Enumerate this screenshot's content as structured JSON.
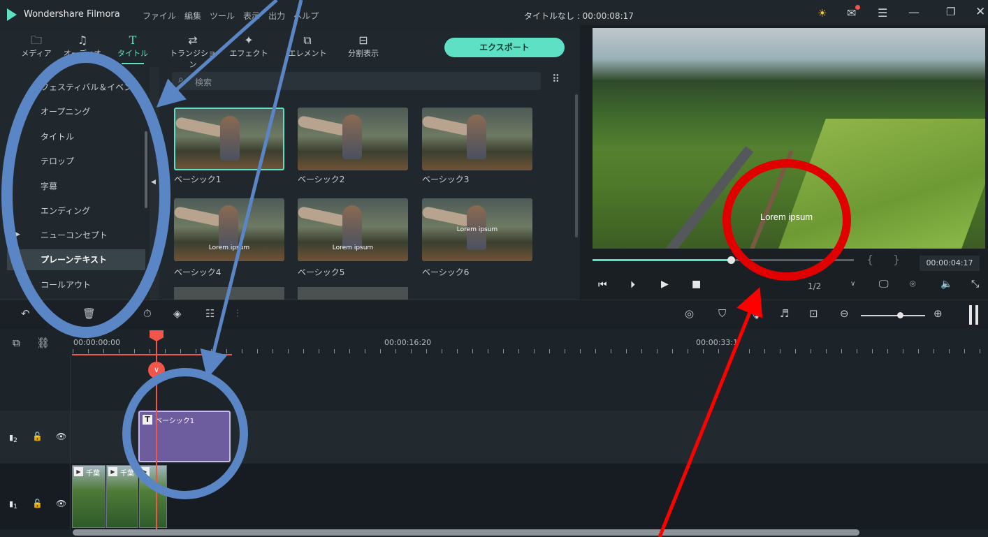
{
  "window": {
    "app_name": "Wondershare Filmora",
    "title": "タイトルなし : 00:00:08:17",
    "menu": [
      "ファイル",
      "編集",
      "ツール",
      "表示",
      "出力",
      "ヘルプ"
    ]
  },
  "toolbar": {
    "tabs": [
      {
        "label": "メディア",
        "icon": "folder-icon"
      },
      {
        "label": "オーディオ",
        "icon": "music-note-icon"
      },
      {
        "label": "タイトル",
        "icon": "title-t-icon"
      },
      {
        "label": "トランジション",
        "icon": "transition-icon"
      },
      {
        "label": "エフェクト",
        "icon": "effect-icon"
      },
      {
        "label": "エレメント",
        "icon": "element-icon"
      },
      {
        "label": "分割表示",
        "icon": "split-screen-icon"
      }
    ],
    "export_label": "エクスポート"
  },
  "sidebar": {
    "categories": [
      "フェスティバル＆イベント",
      "オープニング",
      "タイトル",
      "テロップ",
      "字幕",
      "エンディング",
      "ニューコンセプト",
      "プレーンテキスト",
      "コールアウト"
    ],
    "selected": "プレーンテキスト"
  },
  "search": {
    "placeholder": "検索"
  },
  "library": {
    "items": [
      {
        "label": "ベーシック1",
        "caption": ""
      },
      {
        "label": "ベーシック2",
        "caption": ""
      },
      {
        "label": "ベーシック3",
        "caption": ""
      },
      {
        "label": "ベーシック4",
        "caption": "Lorem ipsum"
      },
      {
        "label": "ベーシック5",
        "caption": "Lorem ipsum"
      },
      {
        "label": "ベーシック6",
        "caption": "Lorem ipsum"
      }
    ]
  },
  "preview": {
    "overlay_text": "Lorem ipsum",
    "timecode": "00:00:04:17",
    "progress": 0.53,
    "zoom": "1/2"
  },
  "timeline": {
    "ruler": [
      "00:00:00:00",
      "00:00:16:20",
      "00:00:33:1"
    ],
    "title_clip": "ベーシック1",
    "video_clip_label": "千葉",
    "track2_label": "2",
    "track1_label": "1"
  },
  "colors": {
    "accent": "#5de0c3",
    "playhead": "#f2554a",
    "title_clip": "#6e5d9e",
    "annotation_blue": "#5b86c5",
    "annotation_red": "#ff0000"
  }
}
